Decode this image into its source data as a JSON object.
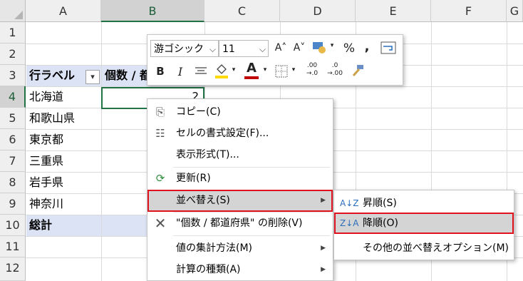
{
  "columns": [
    "A",
    "B",
    "C",
    "D",
    "E",
    "F",
    "G"
  ],
  "rows": [
    "1",
    "2",
    "3",
    "4",
    "5",
    "6",
    "7",
    "8",
    "9",
    "10",
    "11",
    "12"
  ],
  "cells": {
    "a3": "行ラベル",
    "b3": "個数 / 都",
    "a4": "北海道",
    "a5": "和歌山県",
    "a6": "東京都",
    "a7": "三重県",
    "a8": "岩手県",
    "a9": "神奈川",
    "a10": "総計",
    "b4": "2"
  },
  "mini_toolbar": {
    "font_name": "游ゴシック",
    "font_size": "11",
    "grow_font": "A˄",
    "shrink_font": "A˅",
    "percent": "%",
    "comma": ",",
    "bold": "B",
    "italic": "I",
    "font_color_letter": "A",
    "inc_decimal": ".00",
    "dec_decimal": ".0"
  },
  "context_menu": {
    "copy": "コピー(C)",
    "format_cells": "セルの書式設定(F)...",
    "number_format": "表示形式(T)...",
    "refresh": "更新(R)",
    "sort": "並べ替え(S)",
    "remove": "\"個数 / 都道府県\" の削除(V)",
    "summarize_by": "値の集計方法(M)",
    "show_values_as": "計算の種類(A)"
  },
  "sort_submenu": {
    "ascending": "昇順(S)",
    "descending": "降順(O)",
    "more_options": "その他の並べ替えオプション(M)"
  },
  "colors": {
    "selection_green": "#217346",
    "highlight_red": "#e0121d",
    "pivot_header_fill": "#dce3f4",
    "menu_hover": "#d4d4d4"
  }
}
